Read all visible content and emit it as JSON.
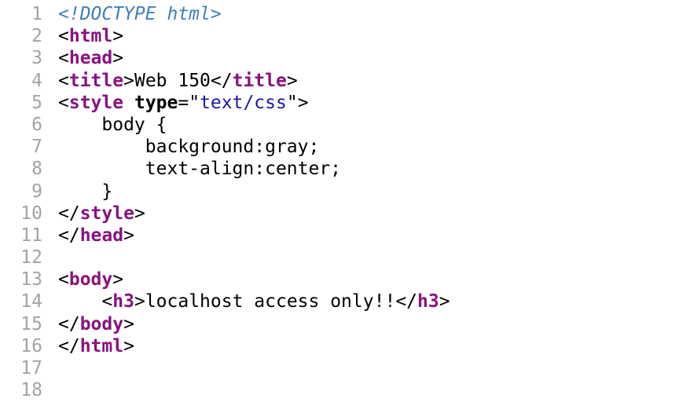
{
  "source_view": {
    "lines": [
      {
        "number": "1",
        "tokens": [
          {
            "t": "doctype",
            "v": "<!DOCTYPE html>"
          }
        ]
      },
      {
        "number": "2",
        "tokens": [
          {
            "t": "tag",
            "v": "<"
          },
          {
            "t": "tagname",
            "v": "html"
          },
          {
            "t": "tag",
            "v": ">"
          }
        ]
      },
      {
        "number": "3",
        "tokens": [
          {
            "t": "tag",
            "v": "<"
          },
          {
            "t": "tagname",
            "v": "head"
          },
          {
            "t": "tag",
            "v": ">"
          }
        ]
      },
      {
        "number": "4",
        "tokens": [
          {
            "t": "tag",
            "v": "<"
          },
          {
            "t": "tagname",
            "v": "title"
          },
          {
            "t": "tag",
            "v": ">"
          },
          {
            "t": "text",
            "v": "Web 150"
          },
          {
            "t": "tag",
            "v": "</"
          },
          {
            "t": "tagname",
            "v": "title"
          },
          {
            "t": "tag",
            "v": ">"
          }
        ]
      },
      {
        "number": "5",
        "tokens": [
          {
            "t": "tag",
            "v": "<"
          },
          {
            "t": "tagname",
            "v": "style"
          },
          {
            "t": "text",
            "v": " "
          },
          {
            "t": "attr",
            "v": "type"
          },
          {
            "t": "text",
            "v": "=\""
          },
          {
            "t": "str",
            "v": "text/css"
          },
          {
            "t": "text",
            "v": "\""
          },
          {
            "t": "tag",
            "v": ">"
          }
        ]
      },
      {
        "number": "6",
        "tokens": [
          {
            "t": "text",
            "v": "    body {"
          }
        ]
      },
      {
        "number": "7",
        "tokens": [
          {
            "t": "text",
            "v": "        background:gray;"
          }
        ]
      },
      {
        "number": "8",
        "tokens": [
          {
            "t": "text",
            "v": "        text-align:center;"
          }
        ]
      },
      {
        "number": "9",
        "tokens": [
          {
            "t": "text",
            "v": "    }"
          }
        ]
      },
      {
        "number": "10",
        "tokens": [
          {
            "t": "tag",
            "v": "</"
          },
          {
            "t": "tagname",
            "v": "style"
          },
          {
            "t": "tag",
            "v": ">"
          }
        ]
      },
      {
        "number": "11",
        "tokens": [
          {
            "t": "tag",
            "v": "</"
          },
          {
            "t": "tagname",
            "v": "head"
          },
          {
            "t": "tag",
            "v": ">"
          }
        ]
      },
      {
        "number": "12",
        "tokens": []
      },
      {
        "number": "13",
        "tokens": [
          {
            "t": "tag",
            "v": "<"
          },
          {
            "t": "tagname",
            "v": "body"
          },
          {
            "t": "tag",
            "v": ">"
          }
        ]
      },
      {
        "number": "14",
        "tokens": [
          {
            "t": "text",
            "v": "    "
          },
          {
            "t": "tag",
            "v": "<"
          },
          {
            "t": "tagname",
            "v": "h3"
          },
          {
            "t": "tag",
            "v": ">"
          },
          {
            "t": "text",
            "v": "localhost access only!!"
          },
          {
            "t": "tag",
            "v": "</"
          },
          {
            "t": "tagname",
            "v": "h3"
          },
          {
            "t": "tag",
            "v": ">"
          }
        ]
      },
      {
        "number": "15",
        "tokens": [
          {
            "t": "tag",
            "v": "</"
          },
          {
            "t": "tagname",
            "v": "body"
          },
          {
            "t": "tag",
            "v": ">"
          }
        ]
      },
      {
        "number": "16",
        "tokens": [
          {
            "t": "tag",
            "v": "</"
          },
          {
            "t": "tagname",
            "v": "html"
          },
          {
            "t": "tag",
            "v": ">"
          }
        ]
      },
      {
        "number": "17",
        "tokens": []
      },
      {
        "number": "18",
        "tokens": []
      }
    ],
    "colors": {
      "line_number": "#a3a3a3",
      "tag_name": "#881280",
      "attribute_value": "#1a1aa6",
      "doctype": "#3f7fbf",
      "background": "#ffffff"
    }
  }
}
